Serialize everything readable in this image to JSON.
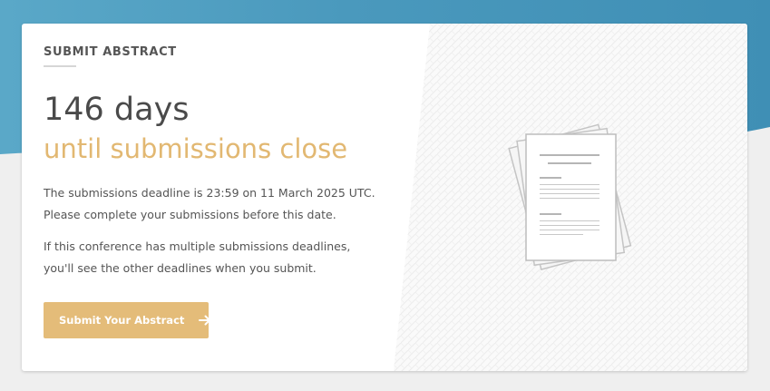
{
  "card": {
    "eyebrow": "SUBMIT ABSTRACT",
    "countdown": "146 days",
    "countdown_caption": "until submissions close",
    "deadline_line1": "The submissions deadline is 23:59 on 11 March 2025 UTC.",
    "deadline_line2": "Please complete your submissions before this date.",
    "multi_line1": "If this conference has multiple submissions deadlines,",
    "multi_line2": "you'll see the other deadlines when you submit.",
    "submit_button": "Submit Your Abstract",
    "submit_icon": "arrow-right-icon",
    "illustration_icon": "document-stack-icon"
  },
  "colors": {
    "accent": "#e4bc79",
    "accent_text": "#e2b872",
    "header_blue": "#4a99bd",
    "text": "#555555",
    "heading": "#4a4a4a"
  }
}
